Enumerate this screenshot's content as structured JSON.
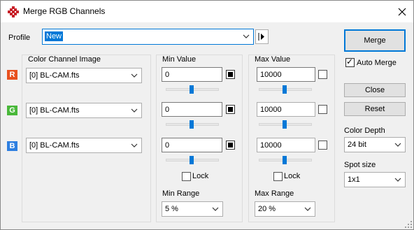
{
  "window": {
    "title": "Merge RGB Channels"
  },
  "profile": {
    "label": "Profile",
    "value": "New"
  },
  "channels_header": "Color Channel Image",
  "channels": [
    {
      "badge": "R",
      "badge_color": "#e8501e",
      "image": "[0] BL-CAM.fts",
      "min": "0",
      "max": "10000"
    },
    {
      "badge": "G",
      "badge_color": "#49b83a",
      "image": "[0] BL-CAM.fts",
      "min": "0",
      "max": "10000"
    },
    {
      "badge": "B",
      "badge_color": "#2e7fe0",
      "image": "[0] BL-CAM.fts",
      "min": "0",
      "max": "10000"
    }
  ],
  "min_panel": {
    "header": "Min Value",
    "lock_label": "Lock",
    "range_label": "Min Range",
    "range_value": "5 %"
  },
  "max_panel": {
    "header": "Max Value",
    "lock_label": "Lock",
    "range_label": "Max Range",
    "range_value": "20 %"
  },
  "actions": {
    "merge_label": "Merge",
    "auto_merge_label": "Auto Merge",
    "auto_merge_checked": true,
    "close_label": "Close",
    "reset_label": "Reset",
    "color_depth_label": "Color Depth",
    "color_depth_value": "24 bit",
    "spot_size_label": "Spot size",
    "spot_size_value": "1x1"
  }
}
